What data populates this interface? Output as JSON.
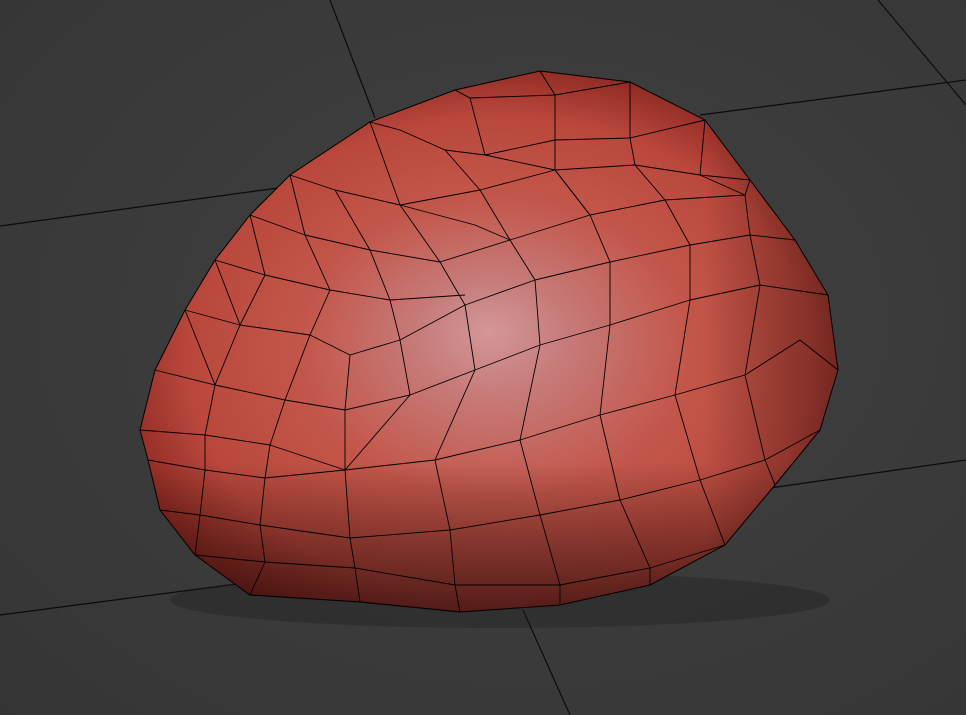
{
  "viewport": {
    "background_color": "#3b3b3b",
    "grid_color": "#0b0b0b",
    "mesh": {
      "surface_color": "#c24a3f",
      "wire_color": "#000000",
      "highlight_color": "#d89aa0",
      "shadow_color": "#3a0c0a"
    }
  }
}
